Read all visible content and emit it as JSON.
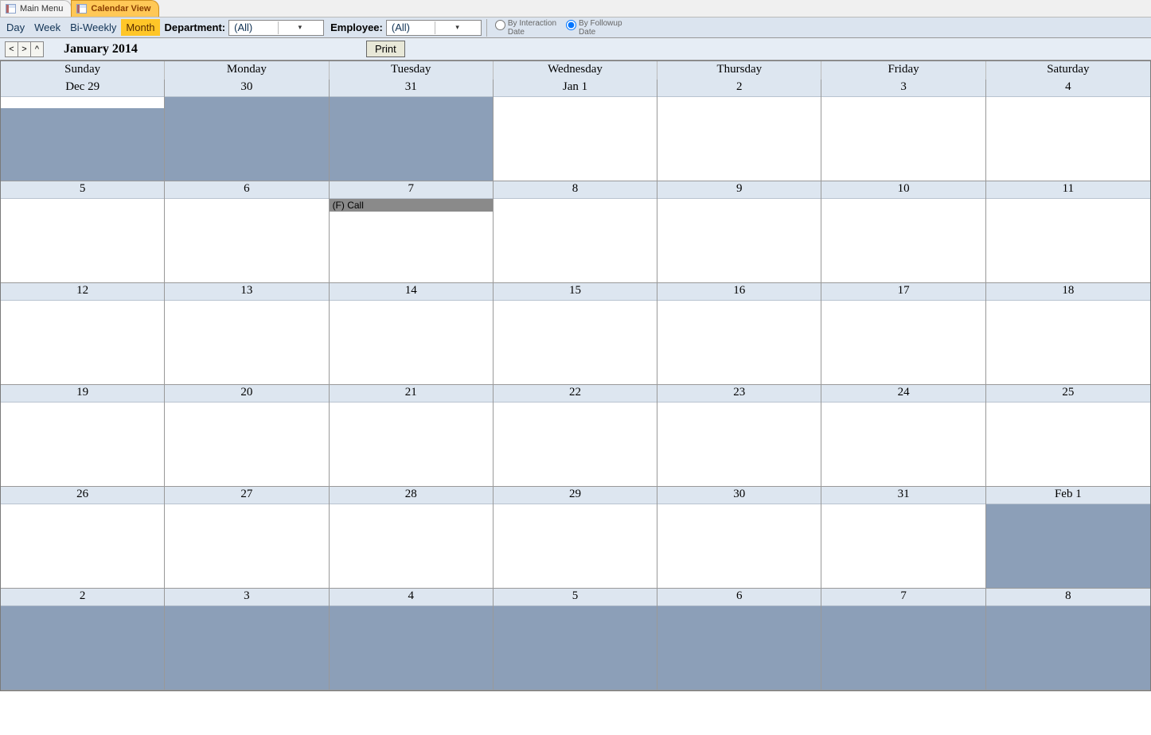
{
  "tabs": [
    {
      "label": "Main Menu",
      "active": false
    },
    {
      "label": "Calendar View",
      "active": true
    }
  ],
  "toolbar": {
    "views": [
      {
        "label": "Day",
        "active": false
      },
      {
        "label": "Week",
        "active": false
      },
      {
        "label": "Bi-Weekly",
        "active": false
      },
      {
        "label": "Month",
        "active": true
      }
    ],
    "department_label": "Department:",
    "department_value": "(All)",
    "employee_label": "Employee:",
    "employee_value": "(All)",
    "radios": {
      "interaction": "By Interaction Date",
      "followup": "By Followup Date",
      "selected": "followup"
    }
  },
  "nav": {
    "prev": "<",
    "next": ">",
    "up": "^",
    "month_title": "January 2014",
    "print": "Print"
  },
  "weekdays": [
    "Sunday",
    "Monday",
    "Tuesday",
    "Wednesday",
    "Thursday",
    "Friday",
    "Saturday"
  ],
  "cells": [
    {
      "label": "Dec 29",
      "outside": true,
      "todayStrip": true
    },
    {
      "label": "30",
      "outside": true
    },
    {
      "label": "31",
      "outside": true
    },
    {
      "label": "Jan 1",
      "outside": false
    },
    {
      "label": "2",
      "outside": false
    },
    {
      "label": "3",
      "outside": false
    },
    {
      "label": "4",
      "outside": false
    },
    {
      "label": "5",
      "outside": false
    },
    {
      "label": "6",
      "outside": false
    },
    {
      "label": "7",
      "outside": false,
      "events": [
        {
          "text": "(F) Call"
        }
      ]
    },
    {
      "label": "8",
      "outside": false
    },
    {
      "label": "9",
      "outside": false
    },
    {
      "label": "10",
      "outside": false
    },
    {
      "label": "11",
      "outside": false
    },
    {
      "label": "12",
      "outside": false
    },
    {
      "label": "13",
      "outside": false
    },
    {
      "label": "14",
      "outside": false
    },
    {
      "label": "15",
      "outside": false
    },
    {
      "label": "16",
      "outside": false
    },
    {
      "label": "17",
      "outside": false
    },
    {
      "label": "18",
      "outside": false
    },
    {
      "label": "19",
      "outside": false
    },
    {
      "label": "20",
      "outside": false
    },
    {
      "label": "21",
      "outside": false
    },
    {
      "label": "22",
      "outside": false
    },
    {
      "label": "23",
      "outside": false
    },
    {
      "label": "24",
      "outside": false
    },
    {
      "label": "25",
      "outside": false
    },
    {
      "label": "26",
      "outside": false
    },
    {
      "label": "27",
      "outside": false
    },
    {
      "label": "28",
      "outside": false
    },
    {
      "label": "29",
      "outside": false
    },
    {
      "label": "30",
      "outside": false
    },
    {
      "label": "31",
      "outside": false
    },
    {
      "label": "Feb 1",
      "outside": true
    },
    {
      "label": "2",
      "outside": true
    },
    {
      "label": "3",
      "outside": true
    },
    {
      "label": "4",
      "outside": true
    },
    {
      "label": "5",
      "outside": true
    },
    {
      "label": "6",
      "outside": true
    },
    {
      "label": "7",
      "outside": true
    },
    {
      "label": "8",
      "outside": true
    }
  ]
}
